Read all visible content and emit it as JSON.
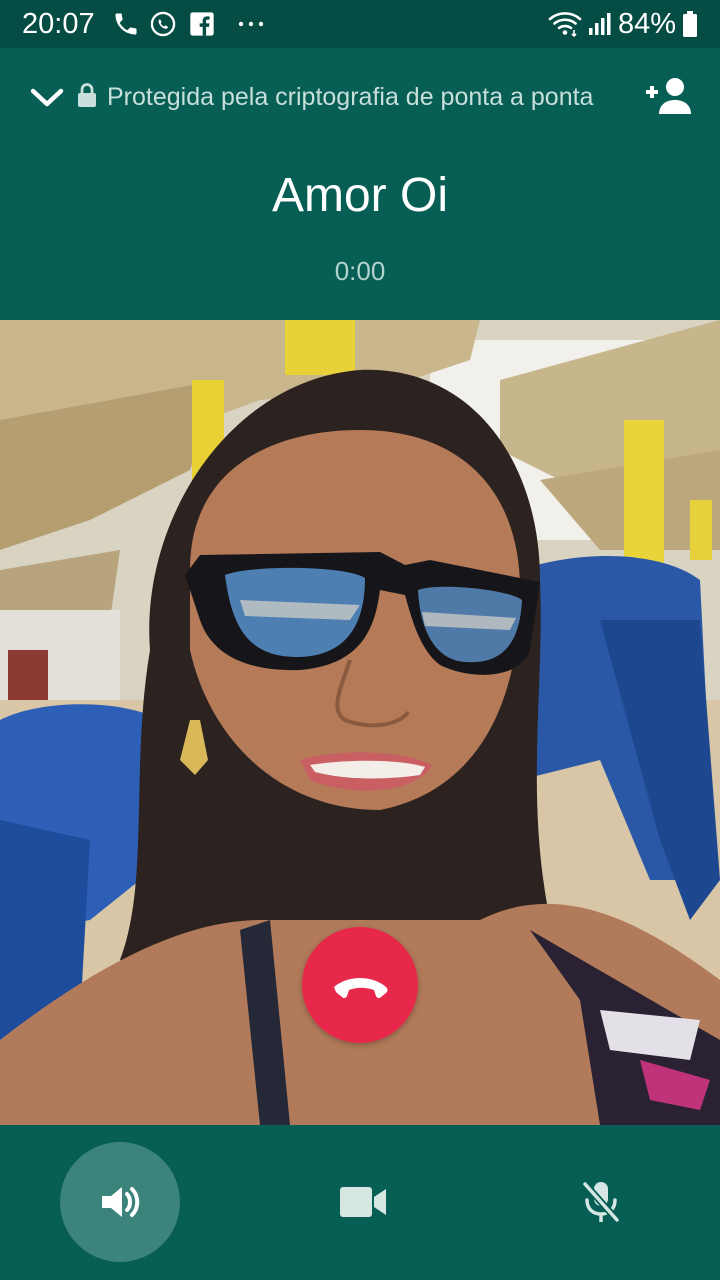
{
  "status_bar": {
    "time": "20:07",
    "battery_percent": "84%",
    "icons": [
      "phone-call-icon",
      "whatsapp-icon",
      "facebook-icon",
      "more-dots-icon",
      "wifi-icon",
      "signal-icon",
      "battery-icon"
    ]
  },
  "header": {
    "encryption_text": "Protegida pela criptografia de ponta a ponta",
    "contact_name": "Amor Oi",
    "call_duration": "0:00"
  },
  "controls": {
    "speaker_active": true,
    "icons": [
      "speaker-icon",
      "video-camera-icon",
      "microphone-muted-icon",
      "end-call-icon"
    ]
  },
  "colors": {
    "header_bg": "#075e54",
    "status_bar_bg": "#054d44",
    "end_call": "#e8284a",
    "active_control_bg": "#3c837b"
  }
}
